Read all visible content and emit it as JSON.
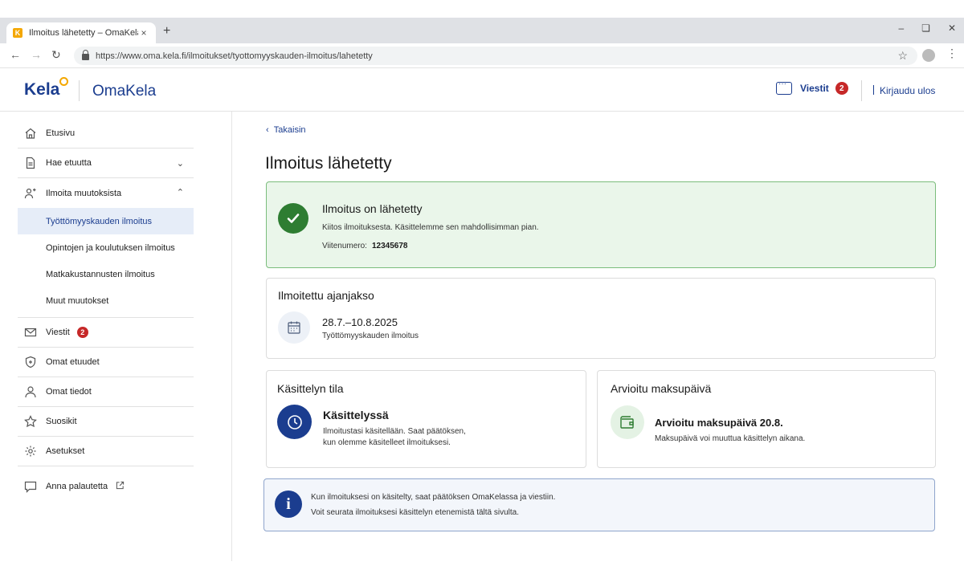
{
  "browser": {
    "tab_title": "Ilmoitus lähetetty – OmaKela",
    "favicon_letter": "K",
    "tab_close": "×",
    "new_tab": "+",
    "url": "https://www.oma.kela.fi/ilmoitukset/tyottomyyskauden-ilmoitus/lahetetty",
    "icons": [
      "back-icon",
      "forward-icon",
      "reload-icon",
      "lock-icon",
      "star-icon",
      "profile-icon",
      "menu-icon"
    ]
  },
  "header": {
    "logo_text": "Kela",
    "app_name": "OmaKela",
    "messages_label": "Viestit",
    "messages_count": "2",
    "logout_label": "Kirjaudu ulos"
  },
  "sidebar": {
    "items": [
      {
        "label": "Etusivu",
        "icon": "home-icon"
      },
      {
        "label": "Hae etuutta",
        "icon": "document-icon"
      },
      {
        "label": "Ilmoita muutoksista",
        "icon": "user-change-icon"
      },
      {
        "label": "Viestit",
        "icon": "mail-icon",
        "badge": "2"
      },
      {
        "label": "Omat etuudet",
        "icon": "shield-icon"
      },
      {
        "label": "Omat tiedot",
        "icon": "person-icon"
      },
      {
        "label": "Suosikit",
        "icon": "star-icon"
      },
      {
        "label": "Asetukset",
        "icon": "gear-icon"
      },
      {
        "label": "Anna palautetta",
        "icon": "feedback-icon"
      }
    ],
    "subitems": [
      {
        "label": "Työttömyyskauden ilmoitus",
        "active": true
      },
      {
        "label": "Opintojen ja koulutuksen ilmoitus"
      },
      {
        "label": "Matkakustannusten ilmoitus"
      },
      {
        "label": "Muut muutokset"
      }
    ]
  },
  "main": {
    "back_label": "Takaisin",
    "page_title": "Ilmoitus lähetetty",
    "success": {
      "title": "Ilmoitus on lähetetty",
      "text": "Kiitos ilmoituksesta. Käsittelemme sen mahdollisimman pian.",
      "ref_label": "Viitenumero:",
      "ref_value": "12345678"
    },
    "period": {
      "title": "Ilmoitettu ajanjakso",
      "dates": "28.7.–10.8.2025",
      "type": "Työttömyyskauden ilmoitus"
    },
    "status": {
      "title": "Käsittelyn tila",
      "state": "Käsittelyssä",
      "desc_line1": "Ilmoitustasi käsitellään. Saat päätöksen,",
      "desc_line2": "kun olemme käsitelleet ilmoituksesi."
    },
    "payment": {
      "title": "Arvioitu maksupäivä",
      "main": "Arvioitu maksupäivä 20.8.",
      "sub": "Maksupäivä voi muuttua käsittelyn aikana."
    },
    "info": {
      "symbol": "i",
      "line1": "Kun ilmoituksesi on käsitelty, saat päätöksen OmaKelassa ja viestiin.",
      "line2": "Voit seurata ilmoituksesi käsittelyn etenemistä tältä sivulta."
    }
  },
  "colors": {
    "brand_blue": "#1b3d8f",
    "success_green": "#2e7d32",
    "badge_red": "#c62828",
    "accent_yellow": "#f4a700"
  }
}
